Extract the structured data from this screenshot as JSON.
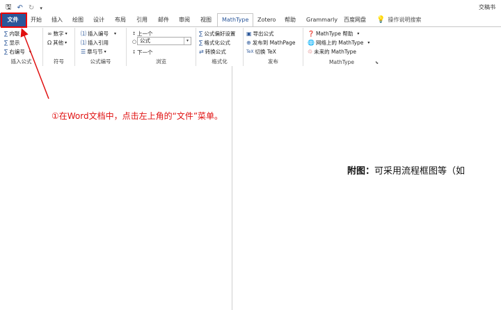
{
  "qat": {
    "save_icon": "save-icon",
    "undo_icon": "undo-icon",
    "redo_icon": "redo-icon",
    "more_icon": "customize-qat-icon"
  },
  "title_right": "交稿书",
  "tabs": [
    "文件",
    "开始",
    "插入",
    "绘图",
    "设计",
    "布局",
    "引用",
    "邮件",
    "审阅",
    "视图",
    "MathType",
    "Zotero",
    "帮助",
    "Grammarly",
    "百度网盘"
  ],
  "search_label": "操作说明搜索",
  "groups": {
    "insert_equation": {
      "label": "插入公式",
      "items": [
        "内联",
        "显示",
        "右编号"
      ]
    },
    "symbols": {
      "label": "符号",
      "items": [
        "数字",
        "其他"
      ]
    },
    "numbering": {
      "label": "公式编号",
      "items": [
        "插入编号",
        "插入引用",
        "章与节"
      ]
    },
    "browse": {
      "label": "浏览",
      "prev": "上一个",
      "combo": "公式",
      "next": "下一个"
    },
    "format": {
      "label": "格式化",
      "items": [
        "公式偏好设置",
        "格式化公式",
        "转换公式"
      ]
    },
    "publish": {
      "label": "发布",
      "items": [
        "导出公式",
        "发布到 MathPage",
        "切换 TeX"
      ]
    },
    "mathtype": {
      "label": "MathType",
      "items": [
        "MathType 帮助",
        "网络上的 MathType",
        "未来的 MathType"
      ]
    }
  },
  "annotation": "①在Word文档中，点击左上角的“文件”菜单。",
  "doc_text_bold": "附图：",
  "doc_text": "可采用流程框图等（如"
}
